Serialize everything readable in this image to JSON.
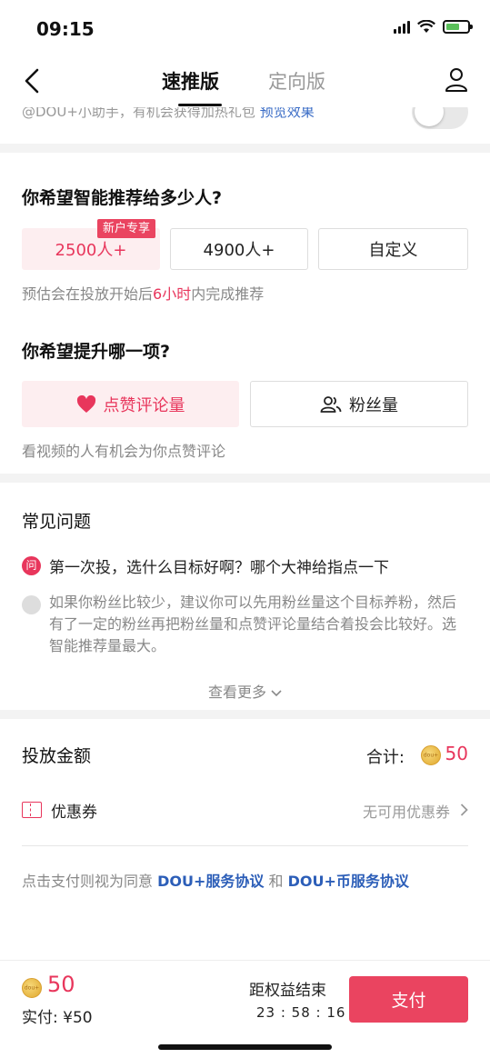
{
  "status_bar": {
    "time": "09:15"
  },
  "nav": {
    "tabs": [
      "速推版",
      "定向版"
    ]
  },
  "prev": {
    "text": "@DOU+小助手，有机会获得加热礼包",
    "link": "预览效果"
  },
  "audience": {
    "question": "你希望智能推荐给多少人?",
    "options": [
      "2500人+",
      "4900人+",
      "自定义"
    ],
    "badge": "新户专享",
    "hint_pre": "预估会在投放开始后",
    "hint_hl": "6小时",
    "hint_post": "内完成推荐"
  },
  "goal": {
    "question": "你希望提升哪一项?",
    "options": [
      "点赞评论量",
      "粉丝量"
    ],
    "hint": "看视频的人有机会为你点赞评论"
  },
  "faq": {
    "title": "常见问题",
    "q_icon": "问",
    "question": "第一次投，选什么目标好啊？哪个大神给指点一下",
    "answer": "如果你粉丝比较少，建议你可以先用粉丝量这个目标养粉，然后有了一定的粉丝再把粉丝量和点赞评论量结合着投会比较好。选智能推荐量最大。",
    "more": "查看更多"
  },
  "payment": {
    "title": "投放金额",
    "total_label": "合计:",
    "total_value": "50",
    "coupon_label": "优惠券",
    "coupon_value": "无可用优惠券",
    "agree_pre": "点击支付则视为同意 ",
    "agree_link1": "DOU+服务协议",
    "agree_mid": " 和 ",
    "agree_link2": "DOU+币服务协议"
  },
  "bottom": {
    "amount": "50",
    "paid": "实付: ¥50",
    "end_label": "距权益结束",
    "timer": "23 : 58 : 16",
    "pay_button": "支付"
  },
  "colors": {
    "accent": "#e8365c",
    "link": "#2c5eb8"
  }
}
